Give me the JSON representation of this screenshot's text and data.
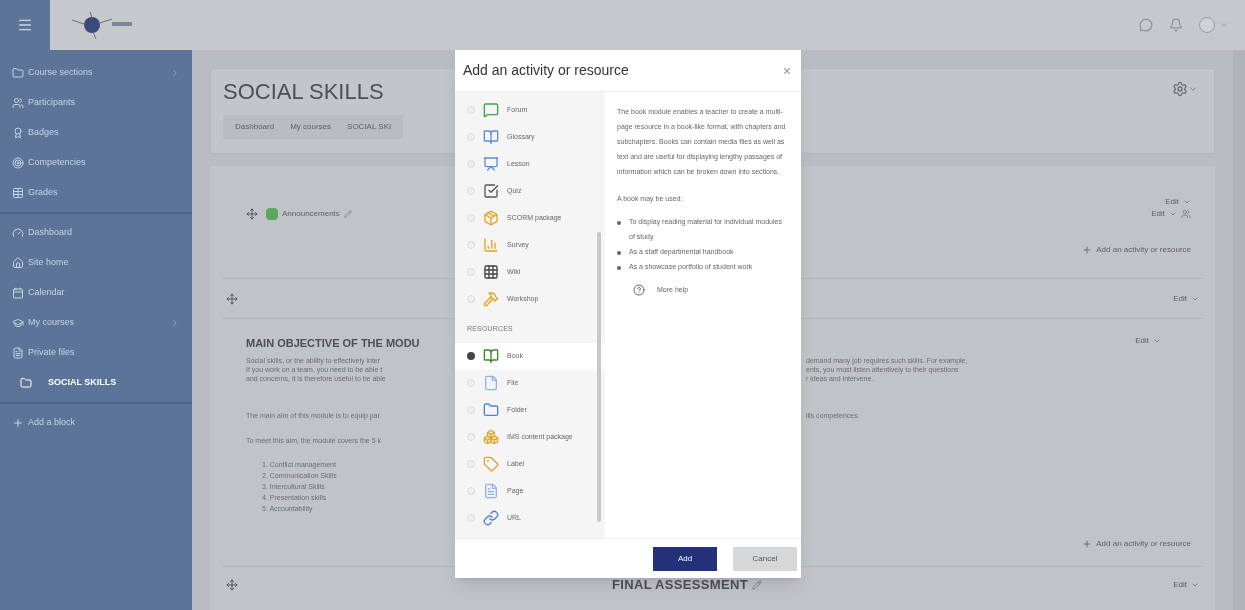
{
  "sidebar": {
    "groups": [
      [
        {
          "label": "Course sections",
          "selected": false,
          "submenu": true
        },
        {
          "label": "Participants",
          "selected": false,
          "submenu": false
        },
        {
          "label": "Badges",
          "selected": false,
          "submenu": false
        },
        {
          "label": "Competencies",
          "selected": false,
          "submenu": false
        },
        {
          "label": "Grades",
          "selected": false,
          "submenu": false
        }
      ],
      [
        {
          "label": "Dashboard",
          "selected": false,
          "submenu": false
        },
        {
          "label": "Site home",
          "selected": false,
          "submenu": false
        },
        {
          "label": "Calendar",
          "selected": false,
          "submenu": false
        },
        {
          "label": "My courses",
          "selected": false,
          "submenu": true
        },
        {
          "label": "Private files",
          "selected": false,
          "submenu": false
        },
        {
          "label": "SOCIAL SKILLS",
          "selected": true,
          "submenu": false
        }
      ],
      [
        {
          "label": "Add a block",
          "selected": false,
          "submenu": false
        }
      ]
    ]
  },
  "header": {
    "title": "SOCIAL SKILLS",
    "breadcrumb": [
      "Dashboard",
      "My courses",
      "SOCIAL SKI"
    ]
  },
  "course": {
    "top_section": {
      "activity": "Announcements",
      "edit_menus": [
        "Edit",
        "Edit"
      ],
      "add_link": "Add an activity or resource"
    },
    "empty_section": {
      "edit": "Edit"
    },
    "objective_section": {
      "heading": "MAIN OBJECTIVE OF THE MODU",
      "edit": "Edit",
      "intro_lines": [
        {
          "left": "Social skills, or the ability to effectively inter",
          "right": "demand many job requires such skills. For example,"
        },
        {
          "left": "If you work on a team, you need to be able t",
          "right": "ents, you must listen attentively to their questions"
        },
        {
          "left": "and concerns, it is therefore useful to be able",
          "right": "r ideas and intervene."
        }
      ],
      "aim_line": {
        "left": "The main aim of this module is to equip par",
        "right": "ills competences."
      },
      "meet_line": "To meet this aim, the module covers the 5 k",
      "list": [
        "1. Conflict management",
        "2. Communication Skills",
        "3. Intercultural Skills",
        "4. Presentation skills",
        "5. Accountability"
      ],
      "add_link": "Add an activity or resource"
    },
    "final_section": {
      "title": "FINAL ASSESSMENT",
      "edit": "Edit"
    }
  },
  "modal": {
    "title": "Add an activity or resource",
    "groups": [
      {
        "items": [
          {
            "label": "Forum",
            "selected": false
          },
          {
            "label": "Glossary",
            "selected": false
          },
          {
            "label": "Lesson",
            "selected": false
          },
          {
            "label": "Quiz",
            "selected": false
          },
          {
            "label": "SCORM package",
            "selected": false
          },
          {
            "label": "Survey",
            "selected": false
          },
          {
            "label": "Wiki",
            "selected": false
          },
          {
            "label": "Workshop",
            "selected": false
          }
        ]
      },
      {
        "heading": "RESOURCES",
        "items": [
          {
            "label": "Book",
            "selected": true
          },
          {
            "label": "File",
            "selected": false
          },
          {
            "label": "Folder",
            "selected": false
          },
          {
            "label": "IMS content package",
            "selected": false
          },
          {
            "label": "Label",
            "selected": false
          },
          {
            "label": "Page",
            "selected": false
          },
          {
            "label": "URL",
            "selected": false
          }
        ]
      }
    ],
    "description": "The book module enables a teacher to create a multi-page resource in a book-like format, with chapters and subchapters. Books can contain media files as well as text and are useful for displaying lengthy passages of information which can be broken down into sections.",
    "uses_intro": "A book may be used:",
    "uses": [
      "To display reading material for individual modules of study",
      "As a staff departmental handbook",
      "As a showcase portfolio of student work"
    ],
    "help_link": "More help",
    "buttons": [
      {
        "label": "Add",
        "kind": "primary"
      },
      {
        "label": "Cancel",
        "kind": "secondary"
      }
    ]
  }
}
